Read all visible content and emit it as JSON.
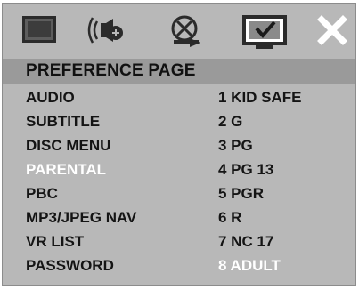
{
  "toolbar": {
    "icons": [
      {
        "name": "display-settings-icon"
      },
      {
        "name": "audio-settings-icon"
      },
      {
        "name": "video-settings-icon"
      },
      {
        "name": "preference-settings-icon"
      },
      {
        "name": "exit-icon"
      }
    ],
    "selected_icon": "preference-settings-icon"
  },
  "header": {
    "title": "PREFERENCE PAGE"
  },
  "menu": {
    "items": [
      {
        "label": "AUDIO",
        "option": "1 KID SAFE"
      },
      {
        "label": "SUBTITLE",
        "option": "2 G"
      },
      {
        "label": "DISC MENU",
        "option": "3 PG"
      },
      {
        "label": "PARENTAL",
        "option": "4 PG 13"
      },
      {
        "label": "PBC",
        "option": "5 PGR"
      },
      {
        "label": "MP3/JPEG NAV",
        "option": "6 R"
      },
      {
        "label": "VR LIST",
        "option": "7 NC 17"
      },
      {
        "label": "PASSWORD",
        "option": "8 ADULT"
      }
    ],
    "selected_item": "PARENTAL",
    "selected_option": "8 ADULT"
  },
  "colors": {
    "background": "#b8b8b8",
    "header_bar": "#9a9a9a",
    "text": "#141414",
    "highlight_text": "#ffffff"
  }
}
